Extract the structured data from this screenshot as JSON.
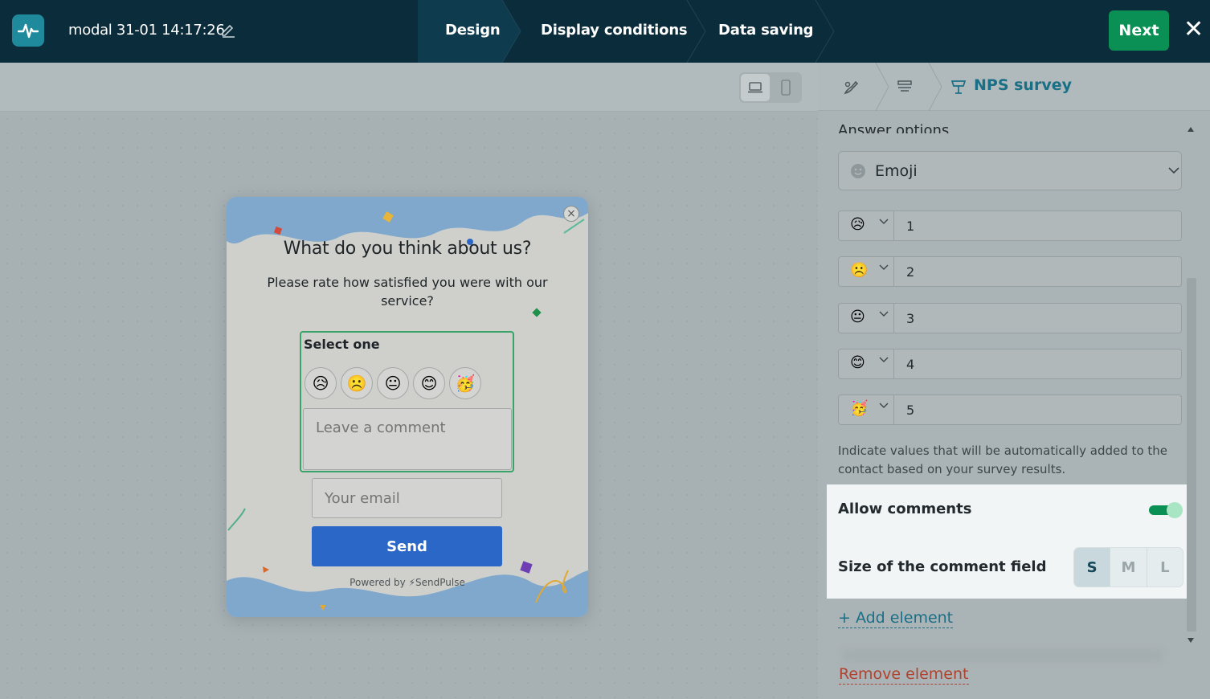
{
  "header": {
    "title": "modal 31-01 14:17:26",
    "steps": [
      {
        "label": "Design",
        "active": true
      },
      {
        "label": "Display conditions",
        "active": false
      },
      {
        "label": "Data saving",
        "active": false
      }
    ],
    "next_label": "Next",
    "close_glyph": "✕",
    "icons": {
      "logo": "pulse-logo-icon",
      "edit": "pencil-icon",
      "close": "close-icon"
    }
  },
  "canvas_toolbar": {
    "device_options": [
      "desktop",
      "mobile"
    ],
    "selected_device": "desktop"
  },
  "modal": {
    "title": "What do you think about us?",
    "subtitle": "Please rate how satisfied you were with our service?",
    "select_label": "Select one",
    "emojis": [
      "😥",
      "☹️",
      "😐",
      "😊",
      "🥳"
    ],
    "comment_placeholder": "Leave a comment",
    "email_placeholder": "Your email",
    "send_label": "Send",
    "powered_by": "Powered by",
    "brand": "SendPulse",
    "close_glyph": "×"
  },
  "panel": {
    "breadcrumb_title": "NPS survey",
    "answer_options_label": "Answer options",
    "answer_type": "Emoji",
    "options": [
      {
        "emoji": "😥",
        "value": "1"
      },
      {
        "emoji": "☹️",
        "value": "2"
      },
      {
        "emoji": "😐",
        "value": "3"
      },
      {
        "emoji": "😊",
        "value": "4"
      },
      {
        "emoji": "🥳",
        "value": "5"
      }
    ],
    "hint": "Indicate values that will be automatically added to the contact based on your survey results.",
    "allow_comments_label": "Allow comments",
    "allow_comments_on": true,
    "size_label": "Size of the comment field",
    "sizes": [
      "S",
      "M",
      "L"
    ],
    "selected_size": "S",
    "add_element": "+ Add element",
    "remove_element": "Remove element"
  },
  "colors": {
    "topbar": "#0b2c3b",
    "accent_green": "#0a8f54",
    "link_teal": "#1a6f86",
    "danger": "#b0432f",
    "send_blue": "#2b67c6"
  }
}
